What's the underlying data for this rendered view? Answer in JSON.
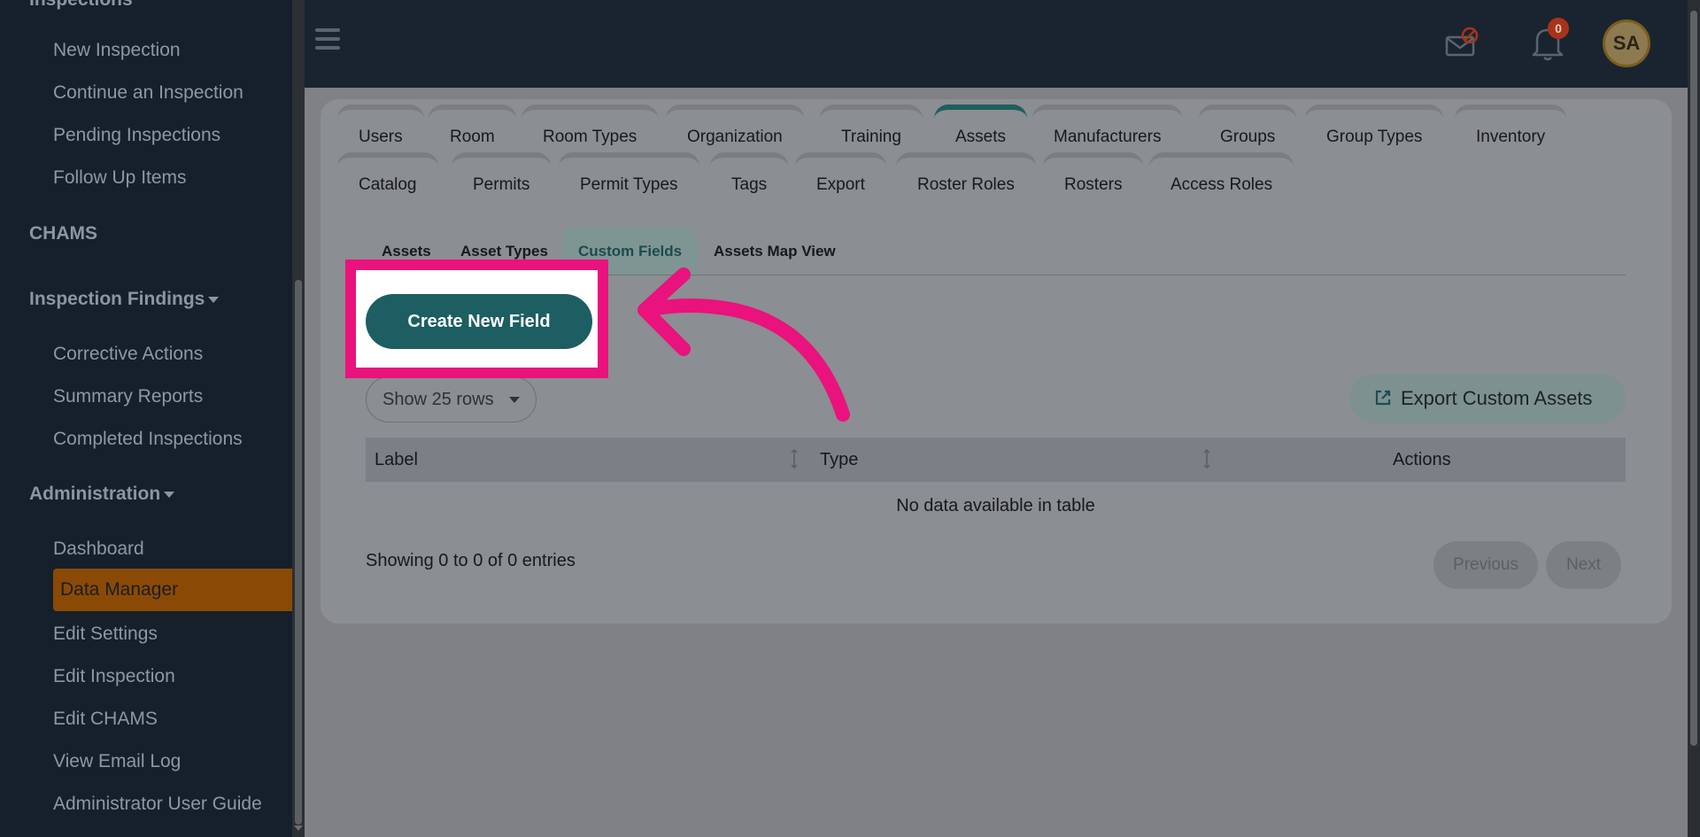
{
  "sidebar": {
    "top_partial": "Inspections",
    "inspections_items": [
      "New Inspection",
      "Continue an Inspection",
      "Pending Inspections",
      "Follow Up Items"
    ],
    "chams": "CHAMS",
    "findings_header": "Inspection Findings",
    "findings_items": [
      "Corrective Actions",
      "Summary Reports",
      "Completed Inspections"
    ],
    "admin_header": "Administration",
    "admin_items": [
      "Dashboard",
      "Data Manager",
      "Edit Settings",
      "Edit Inspection",
      "Edit CHAMS",
      "View Email Log",
      "Administrator User Guide"
    ],
    "active_item": "Data Manager"
  },
  "topbar": {
    "badge_count": "0",
    "avatar_initials": "SA"
  },
  "tabs_row1": [
    "Users",
    "Room",
    "Room Types",
    "Organization",
    "Training",
    "Assets",
    "Manufacturers",
    "Groups",
    "Group Types",
    "Inventory"
  ],
  "tabs_row2": [
    "Catalog",
    "Permits",
    "Permit Types",
    "Tags",
    "Export",
    "Roster Roles",
    "Rosters",
    "Access Roles"
  ],
  "active_tab": "Assets",
  "subtabs": [
    "Assets",
    "Asset Types",
    "Custom Fields",
    "Assets Map View"
  ],
  "active_subtab": "Custom Fields",
  "create_button": "Create New Field",
  "show_rows": "Show 25 rows",
  "export_button": "Export Custom Assets",
  "table": {
    "headers": [
      "Label",
      "Type",
      "Actions"
    ],
    "empty_message": "No data available in table"
  },
  "footer": {
    "showing": "Showing 0 to 0 of 0 entries",
    "previous": "Previous",
    "next": "Next"
  },
  "colors": {
    "highlight": "#ea127c",
    "primary": "#1d5e62",
    "active_sidebar": "#8a4a06"
  }
}
